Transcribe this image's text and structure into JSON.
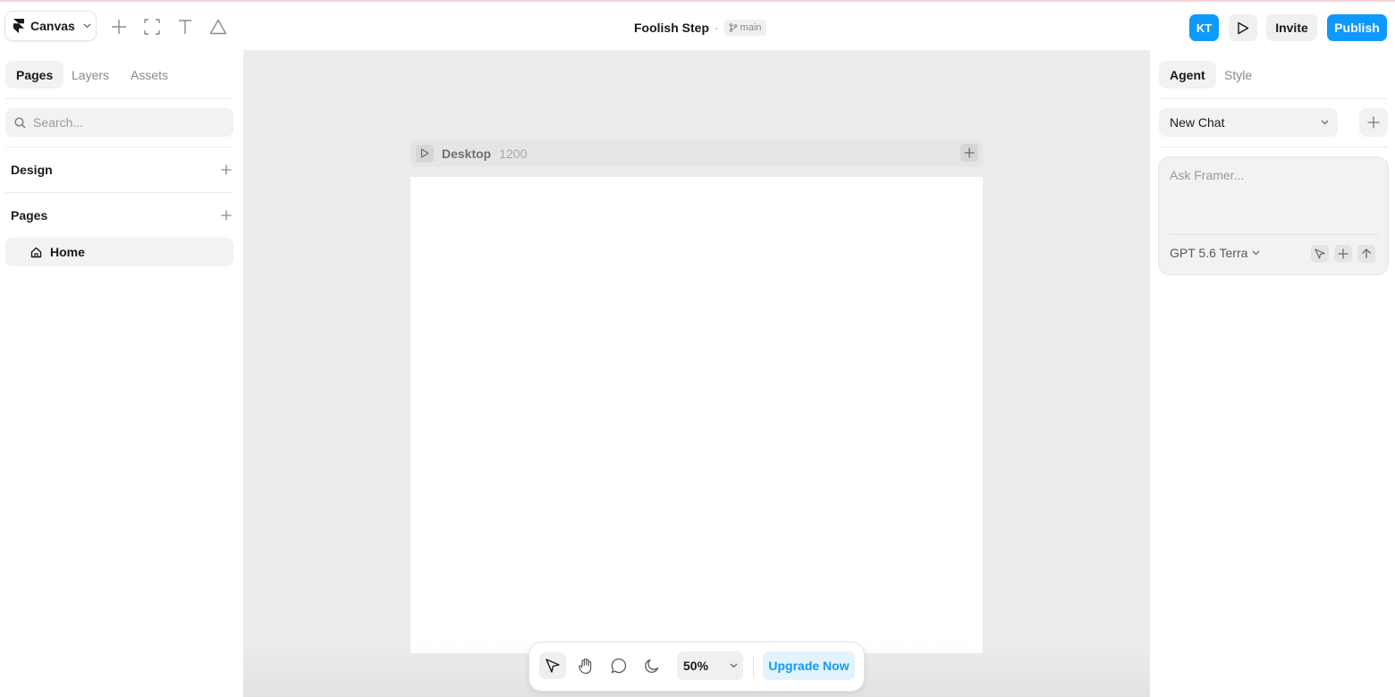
{
  "topbar": {
    "menu_label": "Canvas",
    "project_title": "Foolish Step",
    "title_separator": "·",
    "branch": "main",
    "avatar_initials": "KT",
    "invite_label": "Invite",
    "publish_label": "Publish"
  },
  "left_panel": {
    "tabs": [
      {
        "label": "Pages",
        "active": true
      },
      {
        "label": "Layers",
        "active": false
      },
      {
        "label": "Assets",
        "active": false
      }
    ],
    "search_placeholder": "Search...",
    "sections": {
      "design": "Design",
      "pages": "Pages"
    },
    "pages": [
      {
        "label": "Home",
        "icon": "home-icon"
      }
    ]
  },
  "canvas": {
    "frame_name": "Desktop",
    "frame_width": "1200"
  },
  "bottom_toolbar": {
    "zoom": "50%",
    "upgrade_label": "Upgrade Now"
  },
  "right_panel": {
    "tabs": [
      {
        "label": "Agent",
        "active": true
      },
      {
        "label": "Style",
        "active": false
      }
    ],
    "chat_select": "New Chat",
    "prompt_placeholder": "Ask Framer...",
    "model": "GPT 5.6 Terra"
  },
  "colors": {
    "accent": "#0d99ff",
    "canvas_bg": "#ececec",
    "panel_bg": "#ffffff"
  }
}
